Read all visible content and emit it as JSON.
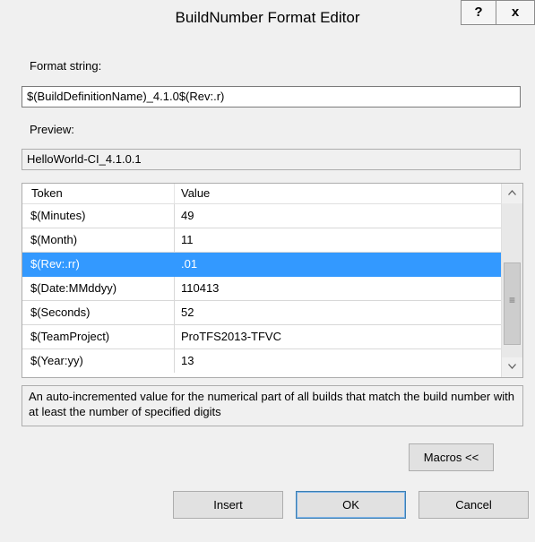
{
  "window": {
    "title": "BuildNumber Format Editor",
    "help_label": "?",
    "close_label": "x"
  },
  "format": {
    "label": "Format string:",
    "value": "$(BuildDefinitionName)_4.1.0$(Rev:.r)"
  },
  "preview": {
    "label": "Preview:",
    "value": "HelloWorld-CI_4.1.0.1"
  },
  "grid": {
    "headers": {
      "token": "Token",
      "value": "Value"
    },
    "rows": [
      {
        "token": "$(Minutes)",
        "value": "49"
      },
      {
        "token": "$(Month)",
        "value": "11"
      },
      {
        "token": "$(Rev:.rr)",
        "value": ".01",
        "selected": true
      },
      {
        "token": "$(Date:MMddyy)",
        "value": "110413"
      },
      {
        "token": "$(Seconds)",
        "value": "52"
      },
      {
        "token": "$(TeamProject)",
        "value": "ProTFS2013-TFVC"
      },
      {
        "token": "$(Year:yy)",
        "value": "13"
      }
    ],
    "scroll_up_icon": "chevron-up-icon",
    "scroll_down_icon": "chevron-down-icon",
    "scroll_grip": "≡"
  },
  "description": "An auto-incremented value for the numerical part of all builds that match the build number with at least the number of specified digits",
  "buttons": {
    "macros": "Macros <<",
    "insert": "Insert",
    "ok": "OK",
    "cancel": "Cancel"
  },
  "colors": {
    "selection": "#3399ff",
    "window_bg": "#f0f0f0",
    "default_button_border": "#3c7fb1"
  }
}
